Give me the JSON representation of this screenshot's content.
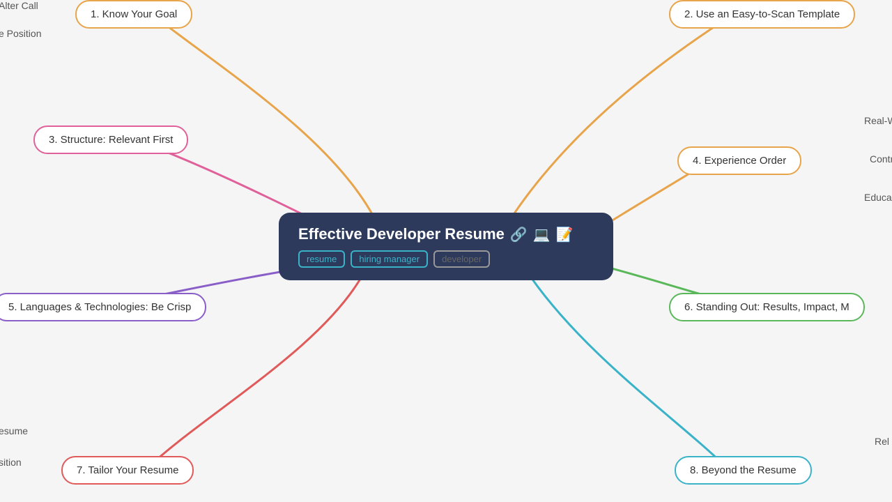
{
  "center": {
    "title": "Effective Developer Resume",
    "icons": "🔗💻📝",
    "tags": [
      "resume",
      "hiring manager",
      "developer"
    ]
  },
  "nodes": [
    {
      "id": "node-1",
      "label": "1. Know Your Goal",
      "color": "#e8a44a"
    },
    {
      "id": "node-2",
      "label": "2. Use an Easy-to-Scan Template",
      "color": "#e8a44a"
    },
    {
      "id": "node-3",
      "label": "3. Structure: Relevant First",
      "color": "#e0619a"
    },
    {
      "id": "node-4",
      "label": "4. Experience Order",
      "color": "#e8a44a"
    },
    {
      "id": "node-5",
      "label": "5. Languages & Technologies: Be Crisp",
      "color": "#8a5ec8"
    },
    {
      "id": "node-6",
      "label": "6. Standing Out: Results, Impact, M",
      "color": "#5ab85a"
    },
    {
      "id": "node-7",
      "label": "7. Tailor Your Resume",
      "color": "#e05a5a"
    },
    {
      "id": "node-8",
      "label": "8. Beyond the Resume",
      "color": "#3ab3c8"
    }
  ],
  "subtexts": {
    "alter_call": "Alter Call",
    "position_top": "e Position",
    "empty": "",
    "real_w": "Real-W",
    "contr": "Contr",
    "educa": "Educa",
    "resume_bottom": "esume",
    "position_bottom": "sition",
    "rel": "Rel"
  },
  "connections": {
    "orange_color": "#e8a44a",
    "pink_color": "#e0619a",
    "purple_color": "#8a5ec8",
    "green_color": "#5ab85a",
    "red_color": "#e05a5a",
    "teal_color": "#3ab3c8"
  },
  "tags": {
    "resume": "resume",
    "hiring_manager": "hiring manager",
    "developer": "developer"
  }
}
